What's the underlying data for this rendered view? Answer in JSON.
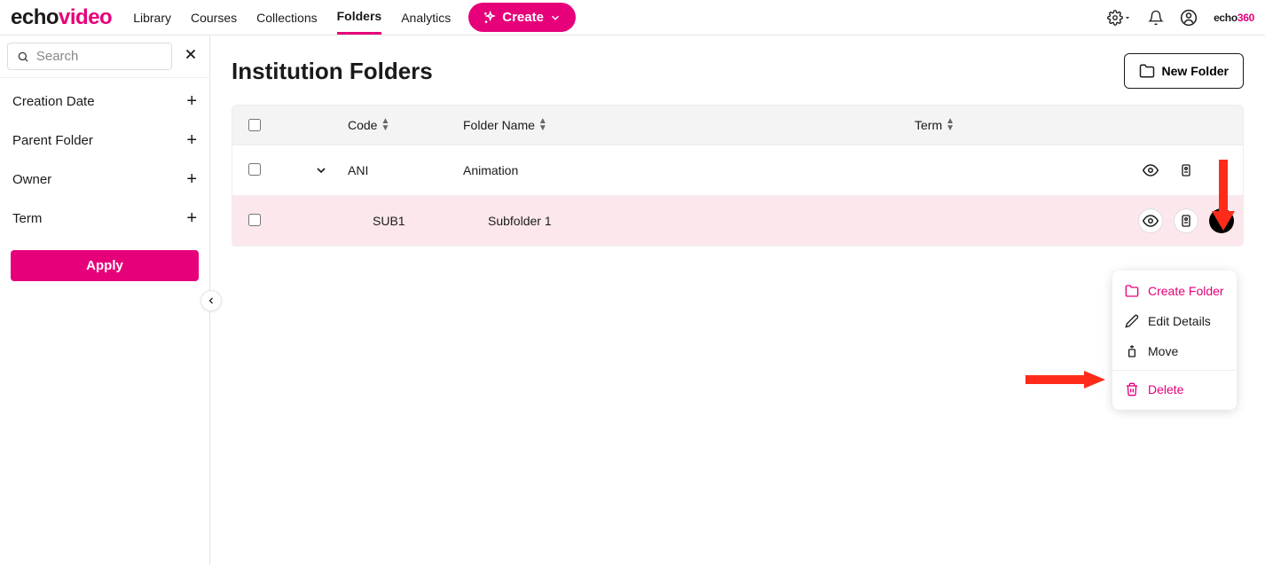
{
  "brand": {
    "part1": "echo",
    "part2": "video",
    "small1": "echo",
    "small2": "360"
  },
  "nav": {
    "library": "Library",
    "courses": "Courses",
    "collections": "Collections",
    "folders": "Folders",
    "analytics": "Analytics",
    "create": "Create"
  },
  "sidebar": {
    "search_placeholder": "Search",
    "filters": {
      "creation_date": "Creation Date",
      "parent_folder": "Parent Folder",
      "owner": "Owner",
      "term": "Term"
    },
    "apply": "Apply"
  },
  "page": {
    "title": "Institution Folders",
    "new_folder": "New Folder"
  },
  "table": {
    "headers": {
      "code": "Code",
      "name": "Folder Name",
      "term": "Term"
    },
    "rows": [
      {
        "code": "ANI",
        "name": "Animation",
        "term": ""
      },
      {
        "code": "SUB1",
        "name": "Subfolder 1",
        "term": ""
      }
    ]
  },
  "menu": {
    "create_folder": "Create Folder",
    "edit_details": "Edit Details",
    "move": "Move",
    "delete": "Delete"
  }
}
